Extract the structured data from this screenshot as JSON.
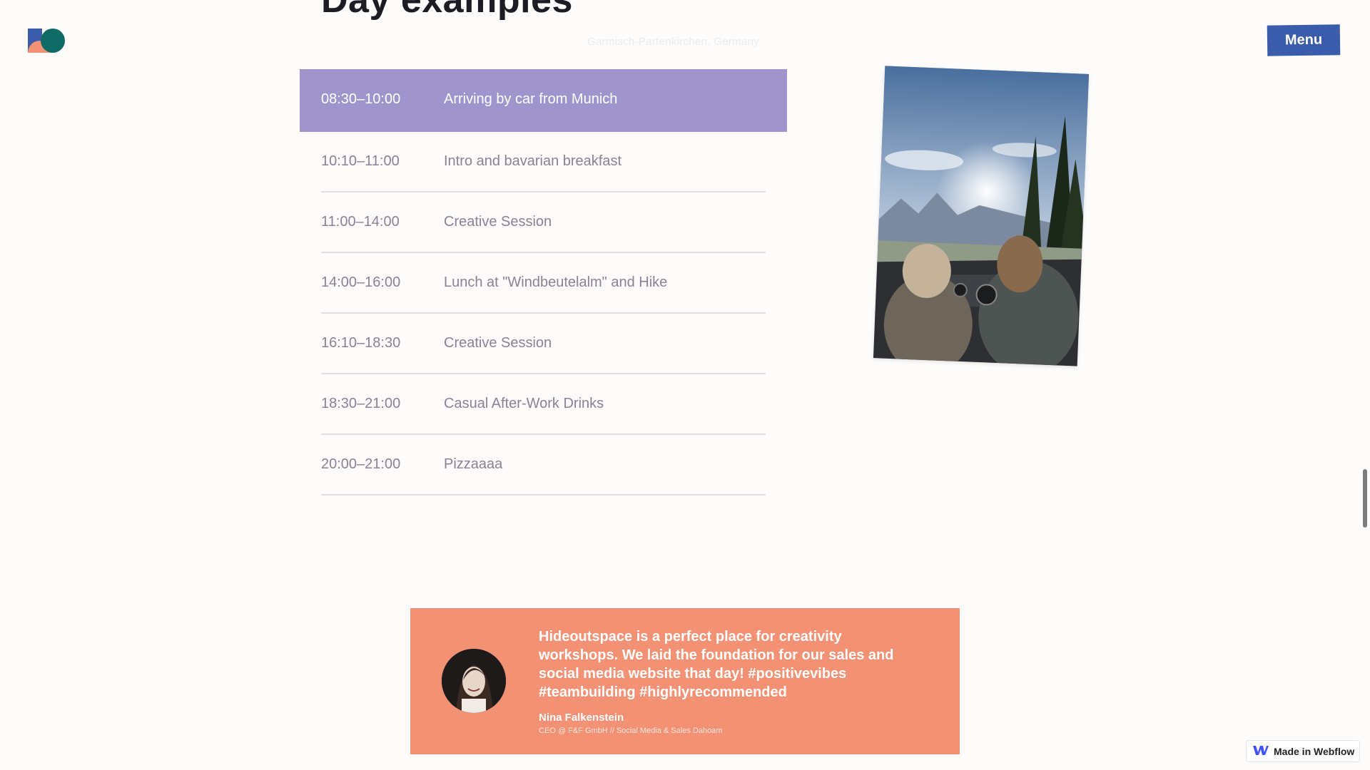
{
  "header": {
    "heading": "Day examples",
    "location": "Garmisch-Partenkirchen, Germany",
    "menu_label": "Menu"
  },
  "schedule": [
    {
      "time": "08:30–10:00",
      "event": "Arriving by car from Munich",
      "active": true
    },
    {
      "time": "10:10–11:00",
      "event": "Intro and bavarian breakfast"
    },
    {
      "time": "11:00–14:00",
      "event": "Creative Session"
    },
    {
      "time": "14:00–16:00",
      "event": "Lunch at \"Windbeutelalm\" and Hike"
    },
    {
      "time": "16:10–18:30",
      "event": "Creative Session"
    },
    {
      "time": "18:30–21:00",
      "event": "Casual After-Work Drinks"
    },
    {
      "time": "20:00–21:00",
      "event": "Pizzaaaa"
    }
  ],
  "testimonial": {
    "quote": "Hideoutspace is a perfect place for creativity workshops. We laid the foundation for our sales and social media website that day! #positivevibes #teambuilding #highlyrecommended",
    "author": "Nina Falkenstein",
    "author_title": "CEO @ F&F GmbH // Social Media & Sales Dahoam"
  },
  "badge": {
    "label": "Made in Webflow"
  },
  "colors": {
    "active_row": "#9f95cc",
    "menu_button": "#3b5cab",
    "testimonial_bg": "#f29173"
  },
  "icons": [
    "logo-icon",
    "webflow-icon"
  ]
}
